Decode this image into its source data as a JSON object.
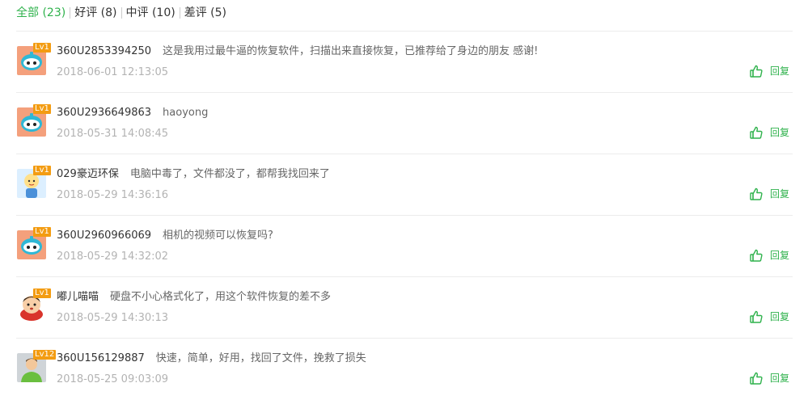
{
  "tabs": [
    {
      "label": "全部",
      "count": "(23)",
      "active": true
    },
    {
      "label": "好评",
      "count": "(8)",
      "active": false
    },
    {
      "label": "中评",
      "count": "(10)",
      "active": false
    },
    {
      "label": "差评",
      "count": "(5)",
      "active": false
    }
  ],
  "reply_label": "回复",
  "colors": {
    "accent": "#2fb24c",
    "badge": "#f39c12",
    "username": "#333333",
    "comment": "#666666",
    "time": "#b3b3b3"
  },
  "comments": [
    {
      "level": "Lv1",
      "avatar": "robot-avatar",
      "user": "360U2853394250",
      "text": "这是我用过最牛逼的恢复软件，扫描出来直接恢复，已推荐给了身边的朋友 感谢!",
      "time": "2018-06-01 12:13:05"
    },
    {
      "level": "Lv1",
      "avatar": "robot-avatar",
      "user": "360U2936649863",
      "text": "haoyong",
      "time": "2018-05-31 14:08:45"
    },
    {
      "level": "Lv1",
      "avatar": "doll-avatar",
      "user": "029豪迈环保",
      "text": "电脑中毒了，文件都没了，都帮我找回来了",
      "time": "2018-05-29 14:36:16"
    },
    {
      "level": "Lv1",
      "avatar": "robot-avatar",
      "user": "360U2960966069",
      "text": "相机的视频可以恢复吗?",
      "time": "2018-05-29 14:32:02"
    },
    {
      "level": "Lv1",
      "avatar": "cartoon-boy-avatar",
      "user": "嘟儿喵喵",
      "text": "硬盘不小心格式化了，用这个软件恢复的差不多",
      "time": "2018-05-29 14:30:13"
    },
    {
      "level": "Lv12",
      "avatar": "default-user-avatar",
      "user": "360U156129887",
      "text": "快速，简单，好用，找回了文件，挽救了损失",
      "time": "2018-05-25 09:03:09"
    }
  ]
}
